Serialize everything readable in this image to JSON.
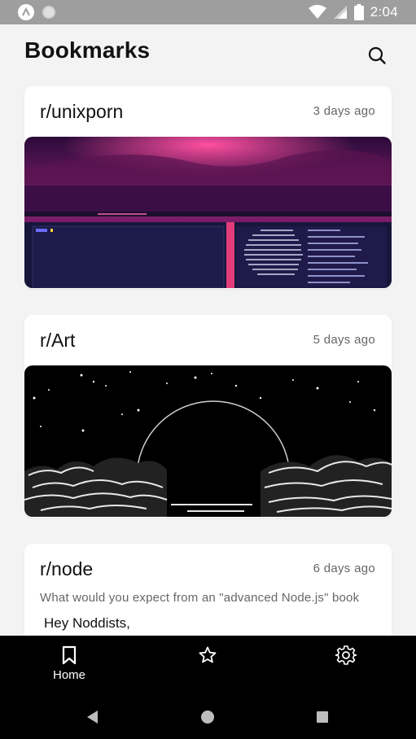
{
  "status_bar": {
    "time": "2:04",
    "icons": [
      "app-badge-icon",
      "circle-notification-icon",
      "wifi-icon",
      "signal-icon",
      "battery-icon"
    ],
    "background": "#9e9e9e"
  },
  "header": {
    "title": "Bookmarks",
    "search_icon": "search-icon"
  },
  "bookmarks": [
    {
      "subreddit": "r/unixporn",
      "time": "3 days ago",
      "media": "image"
    },
    {
      "subreddit": "r/Art",
      "time": "5 days ago",
      "media": "image"
    },
    {
      "subreddit": "r/node",
      "time": "6 days ago",
      "title": "What would you expect from an \"advanced Node.js\" book",
      "body": "Hey Noddists,"
    }
  ],
  "bottom_nav": {
    "items": [
      {
        "label": "Home",
        "icon": "bookmark-icon",
        "active": true
      },
      {
        "label": "",
        "icon": "star-icon",
        "active": false
      },
      {
        "label": "",
        "icon": "gear-icon",
        "active": false
      }
    ]
  },
  "system_nav": {
    "icons": [
      "back-icon",
      "home-icon",
      "recents-icon"
    ]
  },
  "colors": {
    "background": "#f3f3f3",
    "card": "#ffffff",
    "nav": "#000000"
  }
}
